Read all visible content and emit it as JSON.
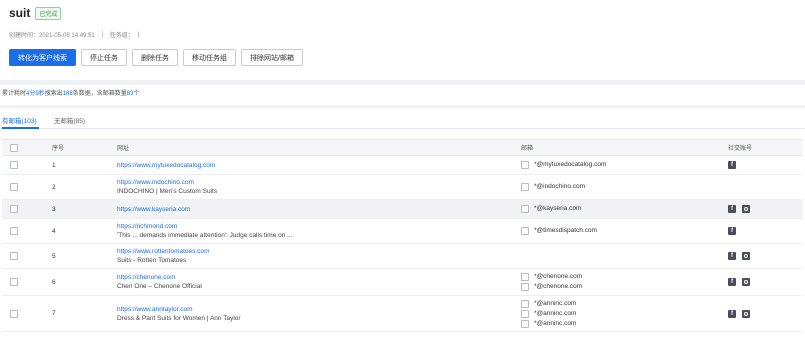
{
  "header": {
    "title": "suit",
    "status_badge": "已完成",
    "created_label": "创建时间：2021-05-08 14:49:51",
    "group_label": "任务组：",
    "group_trailing": "|"
  },
  "actions": [
    {
      "label": "转化为客户线索",
      "primary": true
    },
    {
      "label": "停止任务",
      "primary": false
    },
    {
      "label": "删除任务",
      "primary": false
    },
    {
      "label": "移动任务组",
      "primary": false
    },
    {
      "label": "排除网站/邮箱",
      "primary": false
    }
  ],
  "stats": {
    "prefix": "累计耗时",
    "duration": "4分9秒",
    "mid1": "搜索出",
    "results": "188",
    "mid2": "条数据，含邮箱数量",
    "emails": "83",
    "suffix": "个"
  },
  "tabs": [
    {
      "label": "有邮箱(103)",
      "active": true
    },
    {
      "label": "无邮箱(85)",
      "active": false
    }
  ],
  "columns": {
    "index": "序号",
    "url": "网址",
    "email": "邮箱",
    "social": "社交账号"
  },
  "rows": [
    {
      "index": "1",
      "url": "https://www.mytuxedocatalog.com",
      "desc": "",
      "emails": [
        "*@mytuxedocatalog.com"
      ],
      "social": [
        "facebook-icon"
      ],
      "highlight": false
    },
    {
      "index": "2",
      "url": "https://www.indochino.com",
      "desc": "INDOCHINO | Men's Custom Suits",
      "emails": [
        "*@indochino.com"
      ],
      "social": [],
      "highlight": false
    },
    {
      "index": "3",
      "url": "https://www.kayseria.com",
      "desc": "",
      "emails": [
        "*@kayseria.com"
      ],
      "social": [
        "facebook-icon",
        "instagram-icon"
      ],
      "highlight": true
    },
    {
      "index": "4",
      "url": "https://richmond.com",
      "desc": "'This ... demands immediate attention': Judge calls time on ...",
      "emails": [
        "*@timesdispatch.com"
      ],
      "social": [
        "facebook-icon"
      ],
      "highlight": false
    },
    {
      "index": "5",
      "url": "https://www.rottentomatoes.com",
      "desc": "Suits - Rotten Tomatoes",
      "emails": [],
      "social": [
        "facebook-icon",
        "instagram-icon"
      ],
      "highlight": false
    },
    {
      "index": "6",
      "url": "https://chenone.com",
      "desc": "Chen One – Chenone Official",
      "emails": [
        "*@chenone.com",
        "*@chenone.com"
      ],
      "social": [
        "facebook-icon",
        "instagram-icon"
      ],
      "highlight": false
    },
    {
      "index": "7",
      "url": "https://www.anntaylor.com",
      "desc": "Dress & Pant Suits for Women | Ann Taylor",
      "emails": [
        "*@anninc.com",
        "*@anninc.com",
        "*@anninc.com"
      ],
      "social": [
        "facebook-icon",
        "instagram-icon"
      ],
      "highlight": false
    }
  ]
}
